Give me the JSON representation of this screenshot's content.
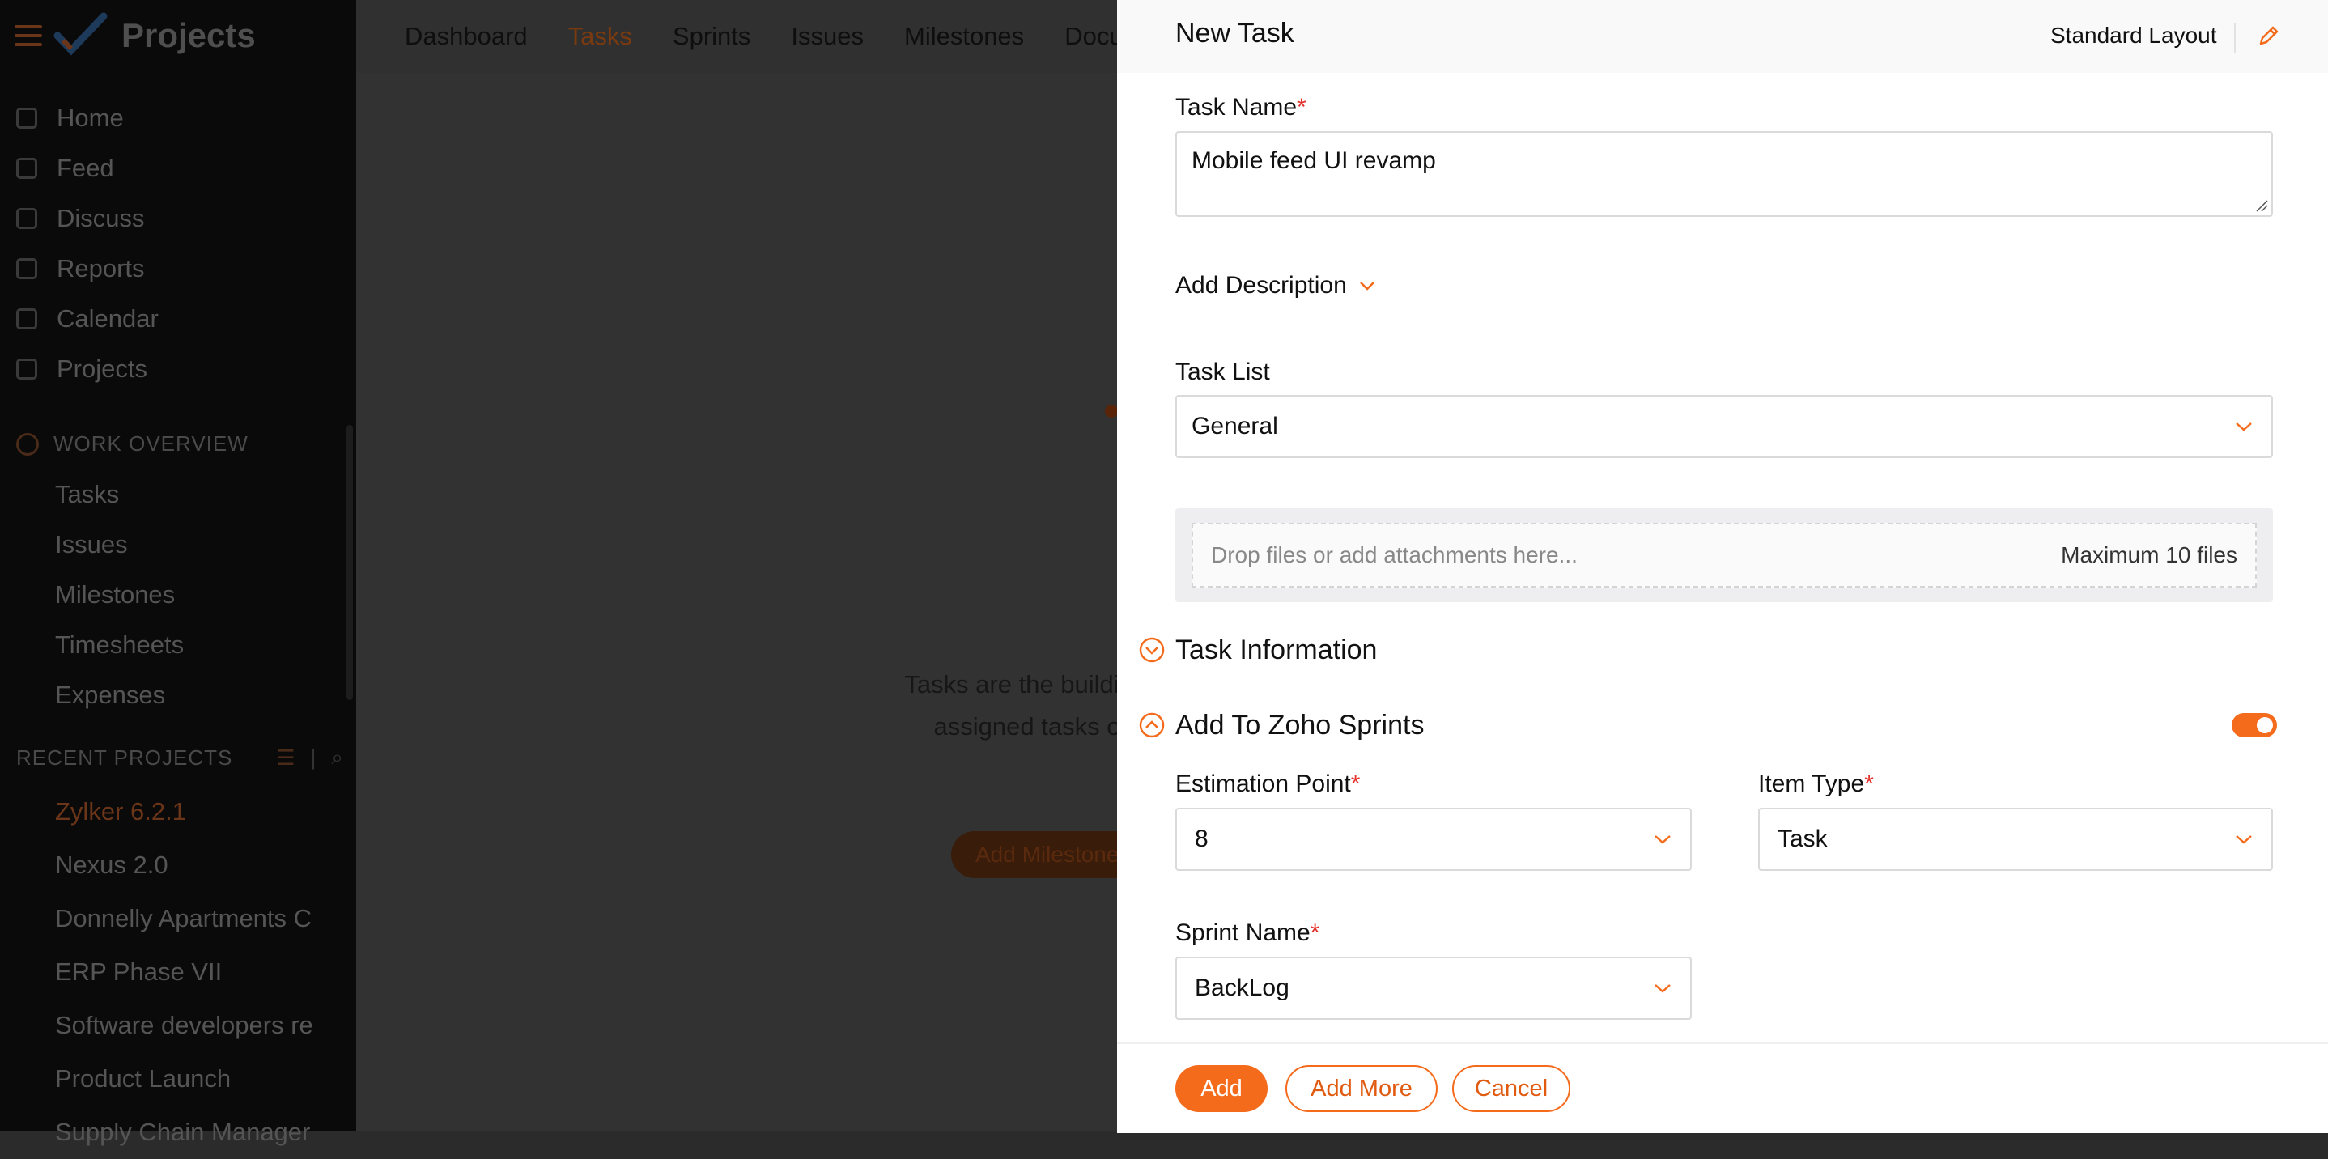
{
  "app": {
    "title": "Projects",
    "topnav": [
      "Dashboard",
      "Tasks",
      "Sprints",
      "Issues",
      "Milestones",
      "Docume"
    ],
    "topnav_active": "Tasks",
    "sidebar": {
      "items": [
        "Home",
        "Feed",
        "Discuss",
        "Reports",
        "Calendar",
        "Projects"
      ],
      "work_overview_title": "WORK OVERVIEW",
      "work_items": [
        "Tasks",
        "Issues",
        "Milestones",
        "Timesheets",
        "Expenses"
      ],
      "recent_title": "RECENT PROJECTS",
      "recent_separator": "|",
      "recent_projects": [
        "Zylker 6.2.1",
        "Nexus 2.0",
        "Donnelly Apartments C",
        "ERP Phase VII",
        "Software developers re",
        "Product Launch",
        "Supply Chain Manager"
      ]
    },
    "main": {
      "empty_line1": "Tasks are the building bloc",
      "empty_line2": "assigned tasks or cre",
      "button": "Add Milestone"
    }
  },
  "panel": {
    "title": "New Task",
    "layout_label": "Standard Layout",
    "task_name_label": "Task Name",
    "task_name_value": "Mobile feed UI revamp",
    "add_description": "Add Description",
    "task_list_label": "Task List",
    "task_list_value": "General",
    "drop_text": "Drop files or add attachments here...",
    "drop_max": "Maximum 10 files",
    "task_information": "Task Information",
    "zoho_sprints": "Add To Zoho Sprints",
    "zoho_sprints_enabled": true,
    "estimation_point_label": "Estimation Point",
    "estimation_point_value": "8",
    "item_type_label": "Item Type",
    "item_type_value": "Task",
    "sprint_name_label": "Sprint Name",
    "sprint_name_value": "BackLog",
    "required_mark": "*"
  },
  "footer": {
    "add": "Add",
    "add_more": "Add More",
    "cancel": "Cancel"
  },
  "colors": {
    "accent": "#f56b1c",
    "required": "#e5322d",
    "overlay": "#2b2b2b"
  }
}
